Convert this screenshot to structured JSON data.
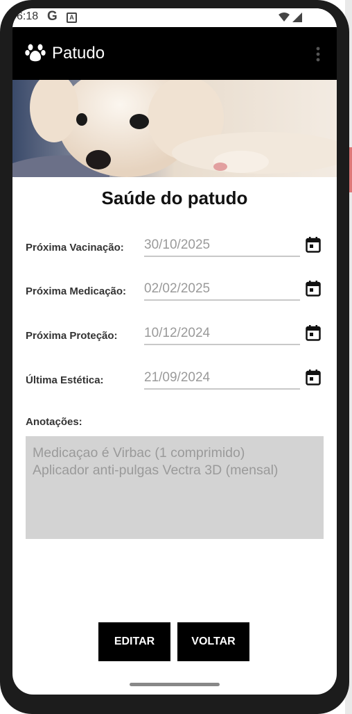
{
  "status": {
    "time": "6:18",
    "g": "G",
    "a": "A"
  },
  "appbar": {
    "title": "Patudo",
    "icon": "paw-icon",
    "menu_icon": "more-vert-icon"
  },
  "hero": {
    "description_icon": "puppy-photo"
  },
  "page": {
    "title": "Saúde do patudo"
  },
  "fields": [
    {
      "label": "Próxima Vacinação:",
      "value": "30/10/2025"
    },
    {
      "label": "Próxima Medicação:",
      "value": "02/02/2025"
    },
    {
      "label": "Próxima Proteção:",
      "value": "10/12/2024"
    },
    {
      "label": "Última Estética:",
      "value": "21/09/2024"
    }
  ],
  "notes": {
    "label": "Anotações:",
    "line1": "Medicaçao é Virbac (1 comprimido)",
    "line2": "Aplicador anti-pulgas Vectra 3D (mensal)"
  },
  "buttons": {
    "edit": "EDITAR",
    "back": "VOLTAR"
  },
  "colors": {
    "appbar": "#000000",
    "button": "#000000",
    "notes_bg": "#d3d3d3"
  }
}
